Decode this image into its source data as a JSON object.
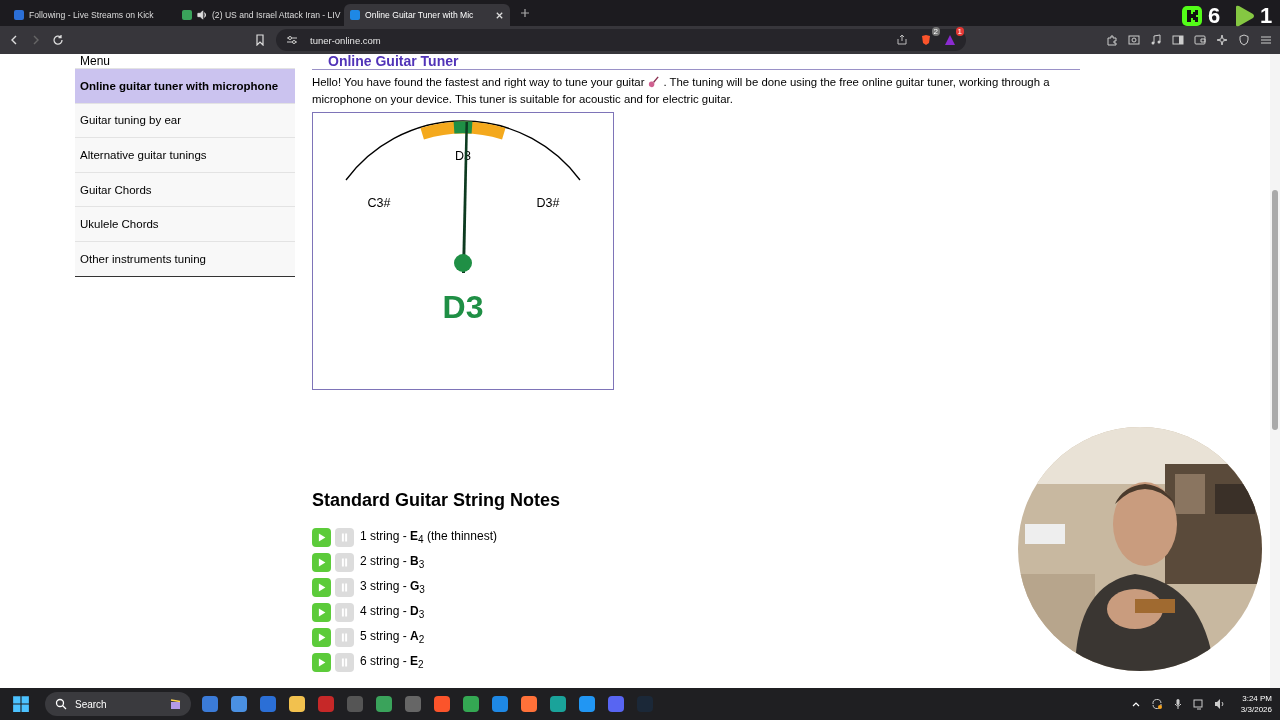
{
  "browser": {
    "tabs": [
      {
        "title": "Following - Live Streams on Kick",
        "selected": false,
        "audio": false
      },
      {
        "title": "(2) US and Israel Attack Iran - LIV",
        "selected": false,
        "audio": true
      },
      {
        "title": "Online Guitar Tuner with Mic",
        "selected": true,
        "audio": false
      }
    ],
    "url": "tuner-online.com",
    "shield_badge": "2",
    "rewards_badge": "1"
  },
  "stream_overlay": {
    "counters": [
      "6",
      "1"
    ]
  },
  "sidebar": {
    "heading": "Menu",
    "items": [
      {
        "label": "Online guitar tuner with microphone",
        "selected": true
      },
      {
        "label": "Guitar tuning by ear",
        "selected": false
      },
      {
        "label": "Alternative guitar tunings",
        "selected": false
      },
      {
        "label": "Guitar Chords",
        "selected": false
      },
      {
        "label": "Ukulele Chords",
        "selected": false
      },
      {
        "label": "Other instruments tuning",
        "selected": false
      }
    ]
  },
  "article": {
    "title": "Online Guitar Tuner",
    "intro_start": "Hello! You have found the fastest and right way to tune your guitar",
    "intro_end": ". The tuning will be done using the free online guitar tuner, working through a",
    "intro_line2": "microphone on your device. This tuner is suitable for acoustic and for electric guitar.",
    "tuner": {
      "center_note": "D3",
      "low_note": "C3#",
      "high_note": "D3#",
      "detected_note": "D3",
      "in_tune": true
    },
    "section_title": "Standard Guitar String Notes",
    "strings": [
      {
        "text": "1 string - **E**$_{4}$ (the thinnest)"
      },
      {
        "text": "2 string - **B**$_{3}$"
      },
      {
        "text": "3 string - **G**$_{3}$"
      },
      {
        "text": "4 string - **D**$_{3}$"
      },
      {
        "text": "5 string - **A**$_{2}$"
      },
      {
        "text": "6 string - **E**$_{2}$"
      }
    ]
  },
  "taskbar": {
    "search_placeholder": "Search",
    "time": "3:24 PM",
    "date": "3/3/2026"
  }
}
